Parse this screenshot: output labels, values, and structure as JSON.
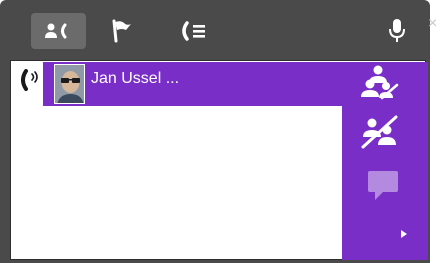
{
  "window": {
    "title": "",
    "close_glyph": "×",
    "accent_color": "#7a2ec8",
    "frame_color": "#4a4a4a"
  },
  "toolbar": {
    "tabs": [
      {
        "icon": "contacts-phone-icon",
        "active": true
      },
      {
        "icon": "flag-icon",
        "active": false
      },
      {
        "icon": "call-list-icon",
        "active": false
      }
    ],
    "mic_icon": "microphone-icon"
  },
  "call": {
    "status_icon": "phone-ringing-icon",
    "contact_name": "Jan Ussel ...",
    "avatar": "avatar-photo"
  },
  "actions": [
    {
      "icon": "transfer-contact-icon"
    },
    {
      "icon": "remove-contact-icon"
    },
    {
      "icon": "chat-bubble-icon"
    },
    {
      "icon": "expand-arrow-icon"
    }
  ]
}
